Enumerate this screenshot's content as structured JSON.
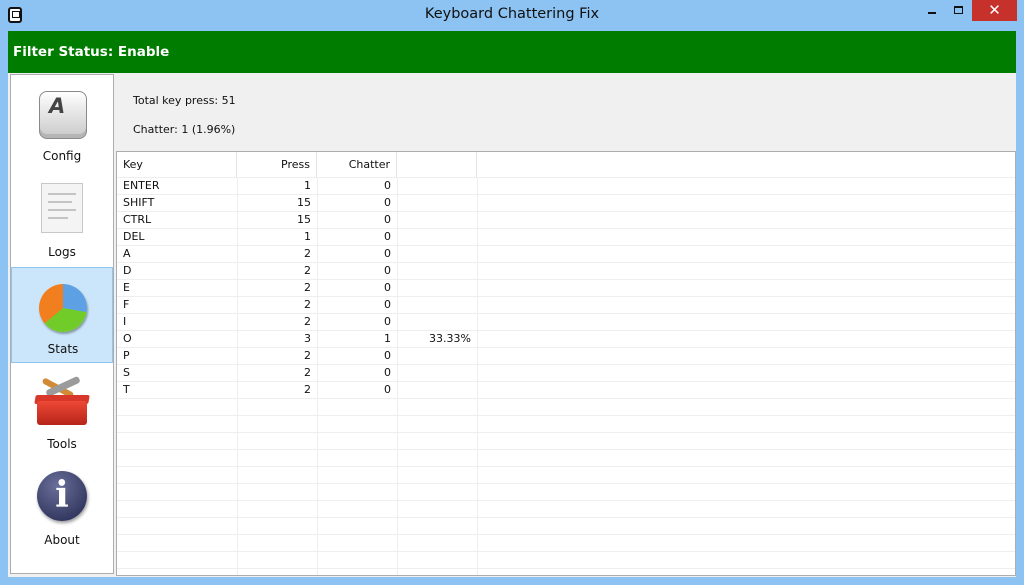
{
  "window": {
    "title": "Keyboard Chattering Fix",
    "close_glyph": "✕"
  },
  "status": {
    "text": "Filter Status: Enable",
    "color": "#007c00"
  },
  "sidebar": {
    "items": [
      {
        "label": "Config",
        "icon": "keyboard-key-icon",
        "icon_glyph": "A"
      },
      {
        "label": "Logs",
        "icon": "document-icon"
      },
      {
        "label": "Stats",
        "icon": "pie-chart-icon",
        "selected": true
      },
      {
        "label": "Tools",
        "icon": "toolbox-icon"
      },
      {
        "label": "About",
        "icon": "info-icon",
        "icon_glyph": "i"
      }
    ]
  },
  "summary": {
    "total": "Total key press: 51",
    "chatter": "Chatter: 1 (1.96%)"
  },
  "table": {
    "columns": [
      "Key",
      "Press",
      "Chatter",
      ""
    ],
    "rows": [
      {
        "key": "ENTER",
        "press": "1",
        "chatter": "0",
        "pct": ""
      },
      {
        "key": "SHIFT",
        "press": "15",
        "chatter": "0",
        "pct": ""
      },
      {
        "key": "CTRL",
        "press": "15",
        "chatter": "0",
        "pct": ""
      },
      {
        "key": "DEL",
        "press": "1",
        "chatter": "0",
        "pct": ""
      },
      {
        "key": "A",
        "press": "2",
        "chatter": "0",
        "pct": ""
      },
      {
        "key": "D",
        "press": "2",
        "chatter": "0",
        "pct": ""
      },
      {
        "key": "E",
        "press": "2",
        "chatter": "0",
        "pct": ""
      },
      {
        "key": "F",
        "press": "2",
        "chatter": "0",
        "pct": ""
      },
      {
        "key": "I",
        "press": "2",
        "chatter": "0",
        "pct": ""
      },
      {
        "key": "O",
        "press": "3",
        "chatter": "1",
        "pct": "33.33%"
      },
      {
        "key": "P",
        "press": "2",
        "chatter": "0",
        "pct": ""
      },
      {
        "key": "S",
        "press": "2",
        "chatter": "0",
        "pct": ""
      },
      {
        "key": "T",
        "press": "2",
        "chatter": "0",
        "pct": ""
      }
    ]
  }
}
